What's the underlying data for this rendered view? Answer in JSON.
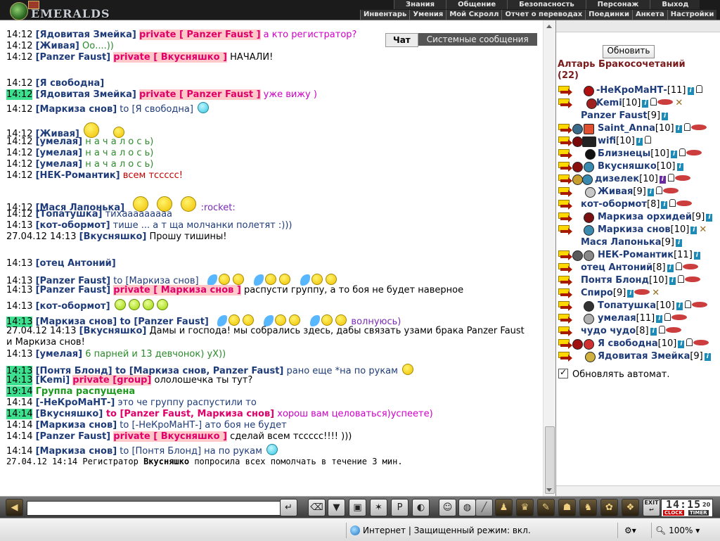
{
  "header": {
    "logo_text": "EMERALDS",
    "menu_top": [
      "Знания",
      "Общение",
      "Безопасность",
      "Персонаж",
      "Выход"
    ],
    "menu_bottom": [
      "Инвентарь",
      "Умения",
      "Мой Скролл",
      "Отчет о переводах",
      "Поединки",
      "Анкета",
      "Настройки"
    ]
  },
  "tabs": {
    "chat": "Чат",
    "system": "Системные сообщения"
  },
  "chat": {
    "l0": {
      "t": "14:12",
      "n": "[Ядовитая Змейка]",
      "pv": "private [ Panzer Faust ]",
      "m": " а кто регистратор?"
    },
    "l1": {
      "t": "14:12",
      "n": "[Живая]",
      "m": " Оо....))"
    },
    "l2": {
      "t": "14:12",
      "n": "[Panzer Faust]",
      "pv": "private [ Вкусняшко ]",
      "m": " НАЧАЛИ!"
    },
    "l3": {
      "t": "14:12",
      "n": "[Я свободна]"
    },
    "l4": {
      "t": "14:12",
      "n": "[Ядовитая Змейка]",
      "pv": "private [ Panzer Faust ]",
      "m": " уже вижу )"
    },
    "l5": {
      "t": "14:12",
      "n": "[Маркиза снов]",
      "to": " to [Я свободна] "
    },
    "l6": {
      "t": "14:12",
      "n": "[Живая]"
    },
    "l7": {
      "t": "14:12",
      "n": "[умелая]",
      "m": " н а ч а л о с ь)"
    },
    "l8": {
      "t": "14:12",
      "n": "[умелая]",
      "m": " н а ч а л о с ь)"
    },
    "l9": {
      "t": "14:12",
      "n": "[умелая]",
      "m": " н а ч а л о с ь)"
    },
    "l10": {
      "t": "14:12",
      "n": "[НЕК-Романтик]",
      "m": " всем тссссс!"
    },
    "l11": {
      "t": "14:12",
      "n": "[Мася Лапонька]",
      "m": ":rocket:"
    },
    "l12": {
      "t": "14:12",
      "n": "[Топатушка]",
      "m": " тихааааааааа"
    },
    "l13": {
      "t": "14:13",
      "n": "[кот-обормот]",
      "m": " тише ... а т ща молчанки полетят :)))"
    },
    "l14": {
      "t": "27.04.12 14:13",
      "n": "[Вкусняшко]",
      "m": " Прошу тишины!"
    },
    "l15": {
      "t": "14:13",
      "n": "[отец Антоний]"
    },
    "l16": {
      "t": "14:13",
      "n": "[Panzer Faust]",
      "to": " to [Маркиза снов]"
    },
    "l17": {
      "t": "14:13",
      "n": "[Panzer Faust]",
      "pv": "private [ Маркиза снов ]",
      "m": " распусти группу, а то боя не будет наверное"
    },
    "l18": {
      "t": "14:13",
      "n": "[кот-обормот]"
    },
    "l19": {
      "t": "14:13",
      "n": "[Маркиза снов]",
      "to": " to [Panzer Faust]",
      "m": " волнуюсь)"
    },
    "l20": {
      "t": "27.04.12 14:13",
      "n": "[Вкусняшко]",
      "m": " Дамы и господа! мы собрались здесь, дабы связать узами брака Panzer Faust"
    },
    "l20b": "и Маркиза снов!",
    "l21": {
      "t": "14:13",
      "n": "[умелая]",
      "m": " 6 парней и 13 девчонок) уХ))"
    },
    "l22": {
      "t": "14:13",
      "n": "[Понтя Блонд]",
      "to": " to [Маркиза снов, Panzer Faust]",
      "m": " рано еще *на по рукам"
    },
    "l23": {
      "t": "14:13",
      "n": "[Kemi]",
      "grp": "private [group]",
      "m": " ололошечка ты тут?"
    },
    "l24": {
      "t": "19:14",
      "m": "Группа распущена"
    },
    "l25": {
      "t": "14:14",
      "n": "[-НеКроМаНТ-]",
      "m": " это че группу распустили то"
    },
    "l26": {
      "t": "14:14",
      "n": "[Вкусняшко]",
      "to": " to [Panzer Faust, Маркиза снов]",
      "m": " хорош вам целоваться)успеете)"
    },
    "l27": {
      "t": "14:14",
      "n": "[Маркиза снов]",
      "to": " to [-НеКроМаНТ-]",
      "m": " ато боя не будет"
    },
    "l28": {
      "t": "14:14",
      "n": "[Panzer Faust]",
      "pv": "private [ Вкусняшко ]",
      "m": " сделай всем тссссс!!!! )))"
    },
    "l29": {
      "t": "14:14",
      "n": "[Маркиза снов]",
      "to": " to [Понтя Блонд]",
      "m": " на по рукам"
    },
    "l30": {
      "t": "27.04.12 14:14",
      "pre": " Регистратор ",
      "b": "Вкусняшко",
      "m": " попросила всех помолчать в течение 3 мин."
    }
  },
  "right": {
    "refresh": "Обновить",
    "title": "Алтарь Бракосочетаний",
    "count": "(22)",
    "players": [
      {
        "name": "-НеКроМаНТ-",
        "lvl": "[11]"
      },
      {
        "name": "Kemi",
        "lvl": "[10]"
      },
      {
        "name": "Panzer Faust",
        "lvl": "[9]"
      },
      {
        "name": "Saint_Anna",
        "lvl": "[10]"
      },
      {
        "name": "wifi",
        "lvl": "[10]"
      },
      {
        "name": "Близнецы",
        "lvl": "[10]"
      },
      {
        "name": "Вкусняшко",
        "lvl": "[10]"
      },
      {
        "name": "дизелек",
        "lvl": "[10]"
      },
      {
        "name": "Живая",
        "lvl": "[9]"
      },
      {
        "name": "кот-обормот",
        "lvl": "[8]"
      },
      {
        "name": "Маркиза орхидей",
        "lvl": "[9]"
      },
      {
        "name": "Маркиза снов",
        "lvl": "[10]"
      },
      {
        "name": "Мася Лапонька",
        "lvl": "[9]"
      },
      {
        "name": "НЕК-Романтик",
        "lvl": "[11]"
      },
      {
        "name": "отец Антоний",
        "lvl": "[8]"
      },
      {
        "name": "Понтя Блонд",
        "lvl": "[10]"
      },
      {
        "name": "Спиро",
        "lvl": "[9]"
      },
      {
        "name": "Топатушка",
        "lvl": "[10]"
      },
      {
        "name": "умелая",
        "lvl": "[11]"
      },
      {
        "name": "чудо чудо",
        "lvl": "[8]"
      },
      {
        "name": "Я свободна",
        "lvl": "[10]"
      },
      {
        "name": "Ядовитая Змейка",
        "lvl": "[9]"
      }
    ],
    "auto_update": "Обновлять автомат."
  },
  "clock": {
    "time": "14:15",
    "sec": "20",
    "clock_label": "CLOCK",
    "timer_label": "TIMER"
  },
  "toolbar": {
    "exit": "EXIT"
  },
  "statusbar": {
    "zone": "Интернет | Защищенный режим: вкл.",
    "zoom": "100%"
  }
}
